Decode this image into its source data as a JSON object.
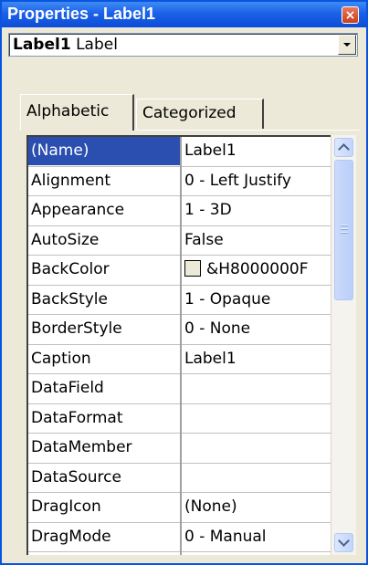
{
  "window": {
    "title": "Properties - Label1",
    "close_icon": "×"
  },
  "object_selector": {
    "object_name": "Label1",
    "object_type": "Label"
  },
  "tabs": [
    {
      "label": "Alphabetic",
      "selected": true
    },
    {
      "label": "Categorized",
      "selected": false
    }
  ],
  "properties": [
    {
      "name": "(Name)",
      "value": "Label1"
    },
    {
      "name": "Alignment",
      "value": "0 - Left Justify"
    },
    {
      "name": "Appearance",
      "value": "1 - 3D"
    },
    {
      "name": "AutoSize",
      "value": "False"
    },
    {
      "name": "BackColor",
      "value": "&H8000000F"
    },
    {
      "name": "BackStyle",
      "value": "1 - Opaque"
    },
    {
      "name": "BorderStyle",
      "value": "0 - None"
    },
    {
      "name": "Caption",
      "value": "Label1"
    },
    {
      "name": "DataField",
      "value": ""
    },
    {
      "name": "DataFormat",
      "value": ""
    },
    {
      "name": "DataMember",
      "value": ""
    },
    {
      "name": "DataSource",
      "value": ""
    },
    {
      "name": "DragIcon",
      "value": "(None)"
    },
    {
      "name": "DragMode",
      "value": "0 - Manual"
    }
  ],
  "colors": {
    "title_bar": "#0d4cd6",
    "selection": "#2b4fb0",
    "backcolor_swatch": "#ece9d8"
  }
}
